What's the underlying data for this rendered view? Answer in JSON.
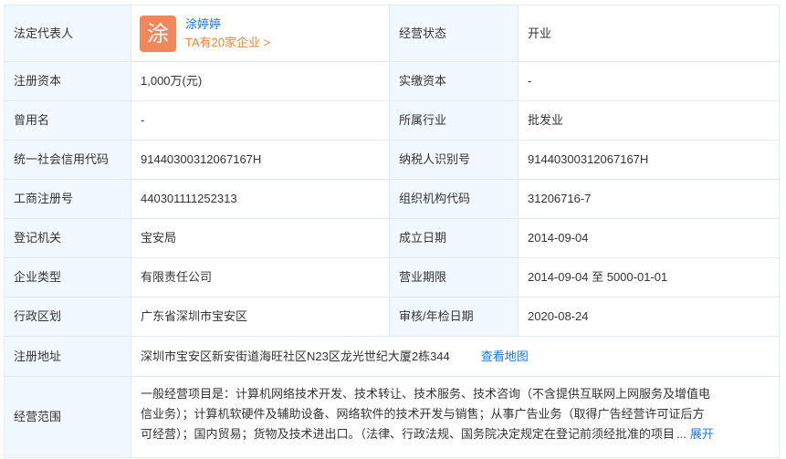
{
  "rows": {
    "r1": {
      "l1": "法定代表人",
      "rep_avatar": "涂",
      "rep_name": "涂婷婷",
      "rep_link": "TA有20家企业 >",
      "l2": "经营状态",
      "v2": "开业"
    },
    "r2": {
      "l1": "注册资本",
      "v1": "1,000万(元)",
      "l2": "实缴资本",
      "v2": "-"
    },
    "r3": {
      "l1": "曾用名",
      "v1": "-",
      "l2": "所属行业",
      "v2": "批发业"
    },
    "r4": {
      "l1": "统一社会信用代码",
      "v1": "91440300312067167H",
      "l2": "纳税人识别号",
      "v2": "91440300312067167H"
    },
    "r5": {
      "l1": "工商注册号",
      "v1": "440301111252313",
      "l2": "组织机构代码",
      "v2": "31206716-7"
    },
    "r6": {
      "l1": "登记机关",
      "v1": "宝安局",
      "l2": "成立日期",
      "v2": "2014-09-04"
    },
    "r7": {
      "l1": "企业类型",
      "v1": "有限责任公司",
      "l2": "营业期限",
      "v2": "2014-09-04 至 5000-01-01"
    },
    "r8": {
      "l1": "行政区划",
      "v1": "广东省深圳市宝安区",
      "l2": "审核/年检日期",
      "v2": "2020-08-24"
    },
    "r9": {
      "l1": "注册地址",
      "v1": "深圳市宝安区新安街道海旺社区N23区龙光世纪大厦2栋344",
      "map_link": "查看地图"
    },
    "r10": {
      "l1": "经营范围",
      "line1": "一般经营项目是：计算机网络技术开发、技术转让、技术服务、技术咨询（不含提供互联网上网服务及增值电",
      "line2": "信业务）；计算机软硬件及辅助设备、网络软件的技术开发与销售；从事广告业务（取得广告经营许可证后方",
      "line3": "可经营）；国内贸易；货物及技术进出口。（法律、行政法规、国务院决定规定在登记前须经批准的项目",
      "ellipsis": "...",
      "expand": "展开"
    }
  },
  "colors": {
    "label_bg": "#f2f8ff",
    "border": "#e4eaf2",
    "link": "#1a73e8",
    "accent_orange": "#f08330",
    "avatar_bg": "#f1875c"
  }
}
